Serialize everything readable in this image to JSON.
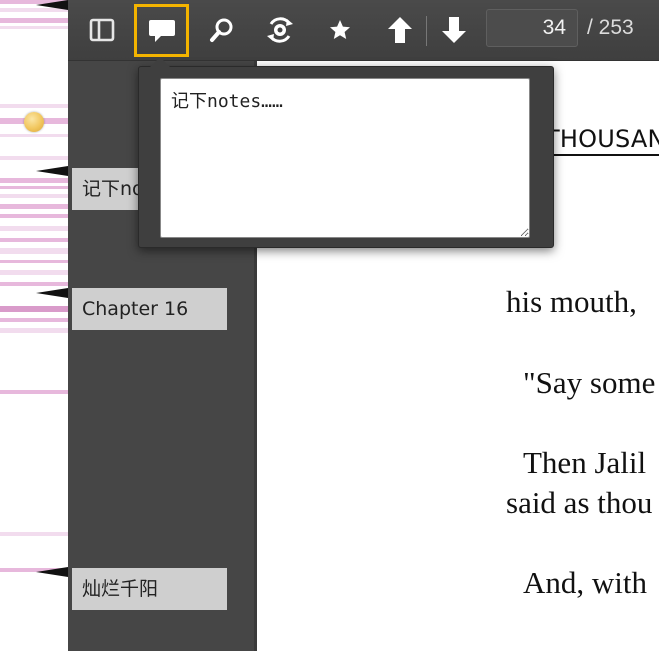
{
  "toolbar": {
    "buttons": [
      {
        "name": "sidebar-toggle-button",
        "icon": "sidebar-panel-icon"
      },
      {
        "name": "notes-button",
        "icon": "speech-bubble-icon",
        "active": true
      },
      {
        "name": "search-button",
        "icon": "magnifier-icon"
      },
      {
        "name": "dictionary-button",
        "icon": "lookup-gear-icon"
      },
      {
        "name": "bookmark-button",
        "icon": "star-icon"
      },
      {
        "name": "previous-page-button",
        "icon": "arrow-up-icon"
      },
      {
        "name": "next-page-button",
        "icon": "arrow-down-icon"
      }
    ],
    "current_page": "34",
    "total_pages": "/ 253",
    "active_color": "#f4b400"
  },
  "note_popup": {
    "text": "记下notes……"
  },
  "sidebar": {
    "bookmarks": [
      {
        "label": "记下notes……"
      },
      {
        "label": "Chapter 16"
      },
      {
        "label": "灿烂千阳"
      }
    ]
  },
  "document": {
    "heading": "THOUSAND",
    "lines": [
      "his mouth, ",
      "\"Say some",
      "Then Jalil",
      "said as thou",
      "And, with",
      "…"
    ]
  },
  "colors": {
    "toolbar_bg": "#444444",
    "sidebar_bg": "#464646",
    "bookmark_bg": "#cfcfcf",
    "highlight_pink": "#e7b8dc"
  }
}
